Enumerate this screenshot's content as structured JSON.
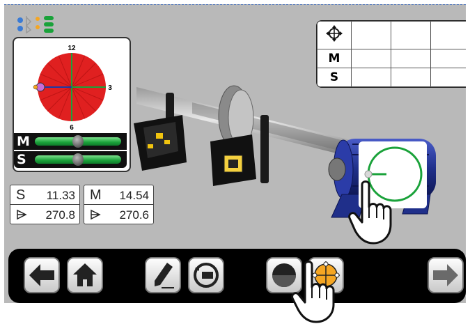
{
  "gauge": {
    "clock_labels": {
      "top": "12",
      "right": "3",
      "bottom": "6"
    },
    "level_m_label": "M",
    "level_s_label": "S",
    "level_m_bubble_fraction": 0.5,
    "level_s_bubble_fraction": 0.5
  },
  "results_table": {
    "header_icon": "target-crosshair-icon",
    "row_labels": [
      "M",
      "S"
    ]
  },
  "readouts": {
    "s": {
      "label": "S",
      "value": "11.33",
      "angle": "270.8"
    },
    "m": {
      "label": "M",
      "value": "14.54",
      "angle": "270.6"
    }
  },
  "toolbar": {
    "buttons": [
      "back-arrow-icon",
      "home-icon",
      "edit-pen-icon",
      "rotate-machine-icon",
      "measure-mode-icon",
      "target-measure-icon",
      "forward-arrow-icon"
    ]
  },
  "colors": {
    "background": "#b9b9b9",
    "gauge_red": "#e02020",
    "level_green": "#1aa23a",
    "motor_blue": "#1f2f8a",
    "accent_orange": "#f5a623"
  }
}
